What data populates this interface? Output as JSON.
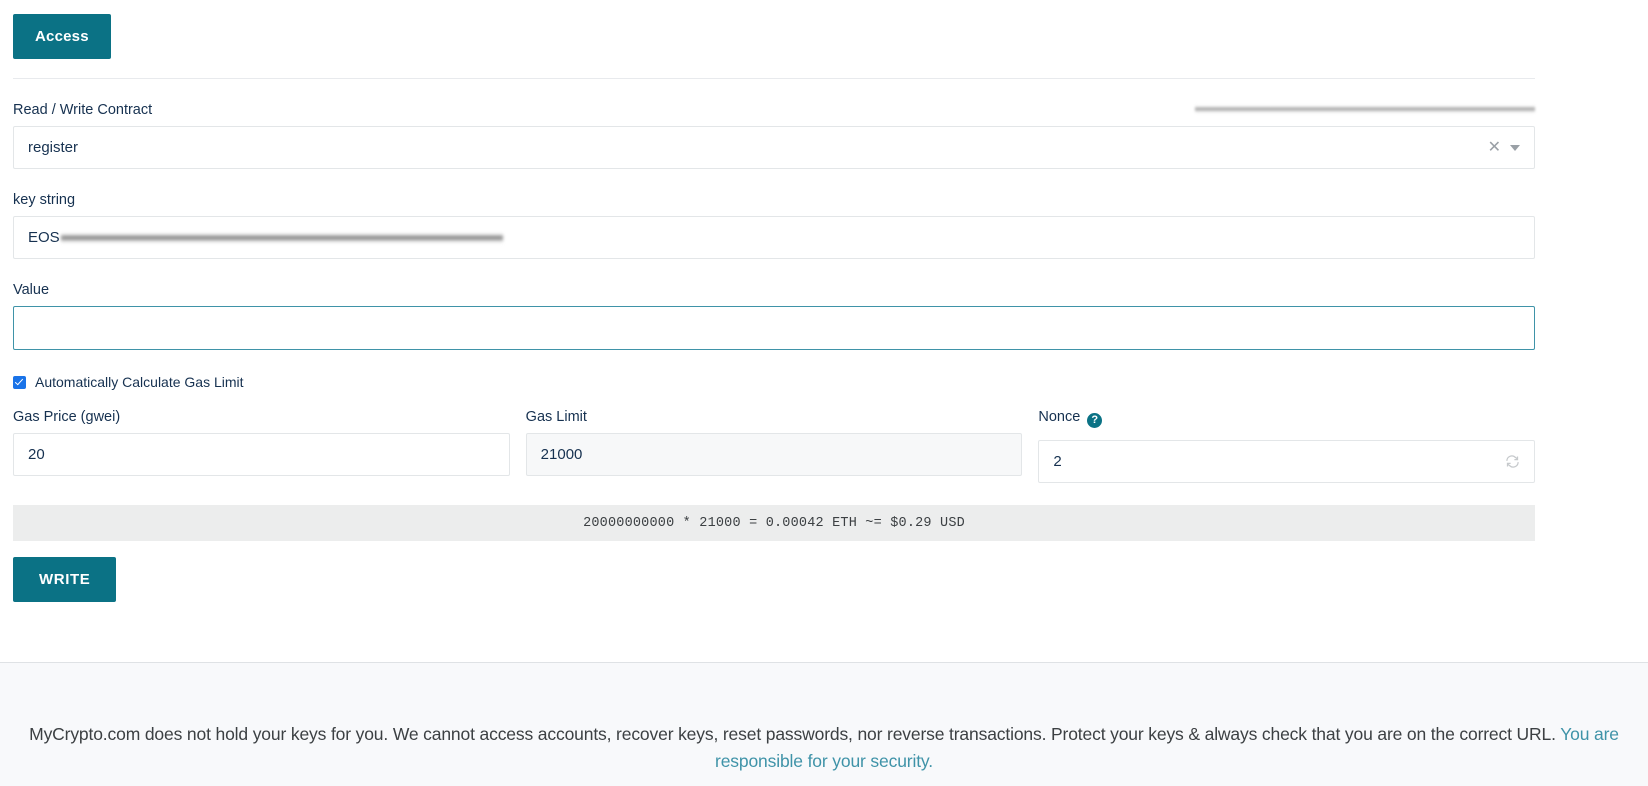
{
  "toolbar": {
    "access_label": "Access"
  },
  "contract": {
    "section_label": "Read / Write Contract",
    "redacted_header": "",
    "selected_function": "register",
    "clear_icon": "close-icon",
    "caret_icon": "chevron-down-icon"
  },
  "key_string": {
    "label": "key string",
    "value": "EOS",
    "redacted_suffix": ""
  },
  "value_field": {
    "label": "Value",
    "value": "",
    "placeholder": ""
  },
  "auto_gas": {
    "label": "Automatically Calculate Gas Limit",
    "checked": true
  },
  "gas": {
    "price_label": "Gas Price (gwei)",
    "price_value": "20",
    "limit_label": "Gas Limit",
    "limit_value": "21000",
    "nonce_label": "Nonce",
    "nonce_value": "2",
    "nonce_help_icon": "question-mark-icon",
    "nonce_refresh_icon": "refresh-icon"
  },
  "cost": {
    "summary": "20000000000 * 21000 = 0.00042 ETH ~= $0.29 USD"
  },
  "actions": {
    "write_label": "WRITE"
  },
  "footer": {
    "disclaimer": "MyCrypto.com does not hold your keys for you. We cannot access accounts, recover keys, reset passwords, nor reverse transactions. Protect your keys & always check that you are on the correct URL. ",
    "link_text": "You are responsible for your security."
  },
  "colors": {
    "accent_teal": "#0b7285",
    "link_teal": "#3f93a8",
    "checkbox_blue": "#1a73e8",
    "cost_bar_bg": "#eceded",
    "footer_bg": "#f8f9fb"
  }
}
